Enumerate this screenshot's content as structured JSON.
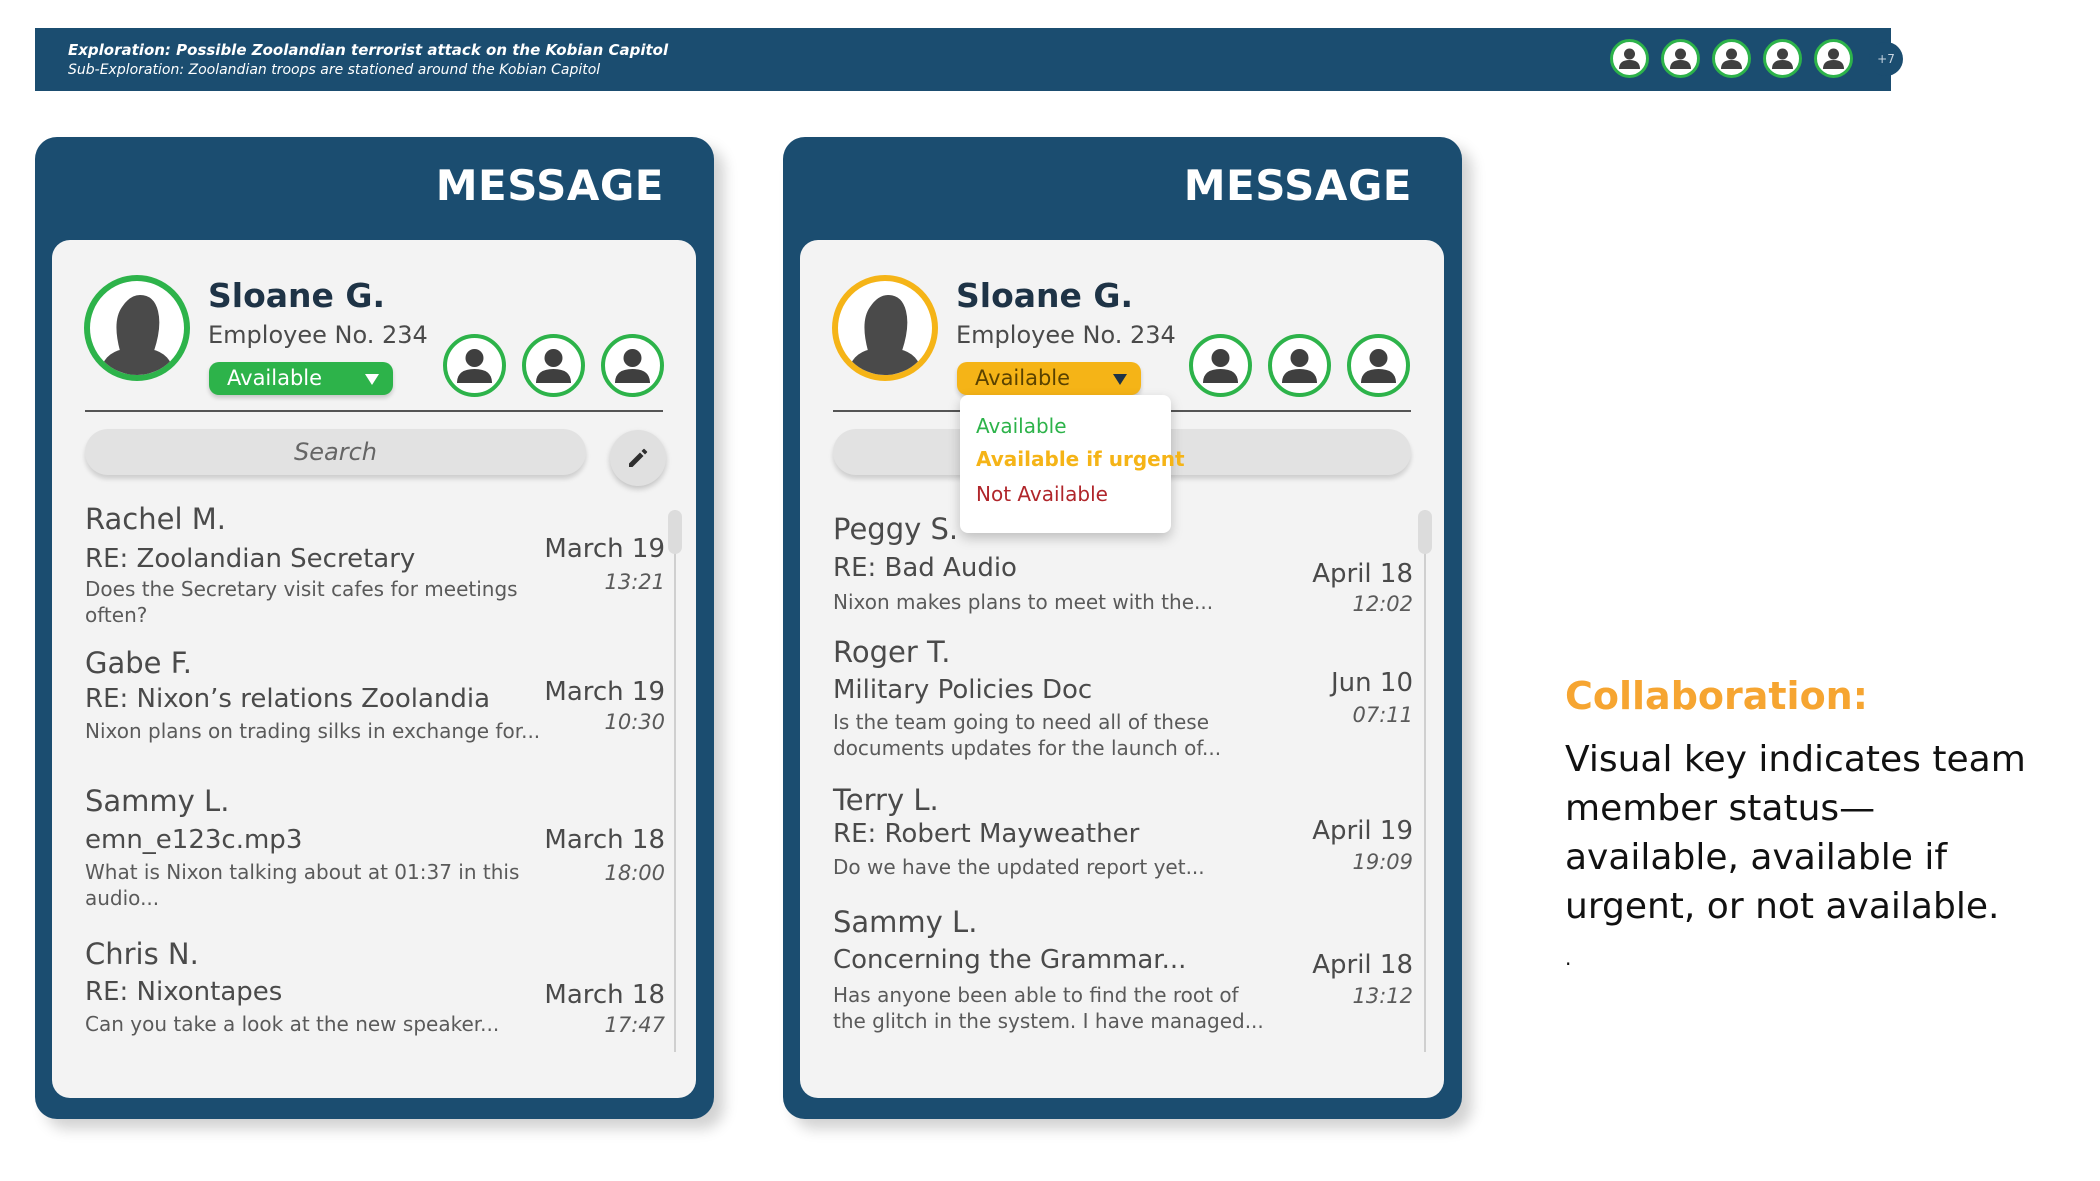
{
  "banner": {
    "exploration": "Exploration: Possible Zoolandian terrorist attack on the Kobian Capitol",
    "sub_exploration": "Sub-Exploration: Zoolandian troops are stationed around the Kobian Capitol",
    "more_count": "+7"
  },
  "colors": {
    "navy": "#1b4d70",
    "available": "#2db34a",
    "available_if_urgent": "#f5b417",
    "not_available": "#b0262b",
    "caption_accent": "#f6a531"
  },
  "panel_a": {
    "title": "MESSAGE",
    "profile": {
      "name": "Sloane G.",
      "employee": "Employee No. 234",
      "status": "Available"
    },
    "search_placeholder": "Search",
    "messages": [
      {
        "sender": "Rachel M.",
        "subject": "RE: Zoolandian Secretary",
        "preview": "Does the Secretary visit cafes for meetings often?",
        "date": "March 19",
        "time": "13:21"
      },
      {
        "sender": "Gabe F.",
        "subject": "RE: Nixon’s relations Zoolandia",
        "preview": "Nixon plans on trading silks in exchange for...",
        "date": "March 19",
        "time": "10:30"
      },
      {
        "sender": "Sammy L.",
        "subject": "emn_e123c.mp3",
        "preview": "What is Nixon talking about at 01:37 in this audio...",
        "date": "March 18",
        "time": "18:00"
      },
      {
        "sender": "Chris N.",
        "subject": "RE: Nixontapes",
        "preview": "Can you take a look at the new speaker...",
        "date": "March 18",
        "time": "17:47"
      }
    ]
  },
  "panel_b": {
    "title": "MESSAGE",
    "profile": {
      "name": "Sloane G.",
      "employee": "Employee No. 234",
      "status": "Available"
    },
    "dropdown_options": [
      "Available",
      "Available if urgent",
      "Not Available"
    ],
    "messages": [
      {
        "sender": "Peggy S.",
        "subject": "RE: Bad Audio",
        "preview": "Nixon makes plans to meet with the...",
        "date": "April 18",
        "time": "12:02"
      },
      {
        "sender": "Roger T.",
        "subject": "Military Policies Doc",
        "preview": "Is the team going to need all of these documents updates for the launch of...",
        "date": "Jun 10",
        "time": "07:11"
      },
      {
        "sender": "Terry L.",
        "subject": "RE: Robert Mayweather",
        "preview": "Do we have the updated report yet...",
        "date": "April 19",
        "time": "19:09"
      },
      {
        "sender": "Sammy L.",
        "subject": "Concerning the Grammar...",
        "preview": "Has anyone been able to find the root of the glitch in the system. I have managed...",
        "date": "April 18",
        "time": "13:12"
      }
    ]
  },
  "caption": {
    "title": "Collaboration:",
    "body": "Visual key indicates team member status—available, available if urgent, or not available.",
    "trailing": "."
  }
}
